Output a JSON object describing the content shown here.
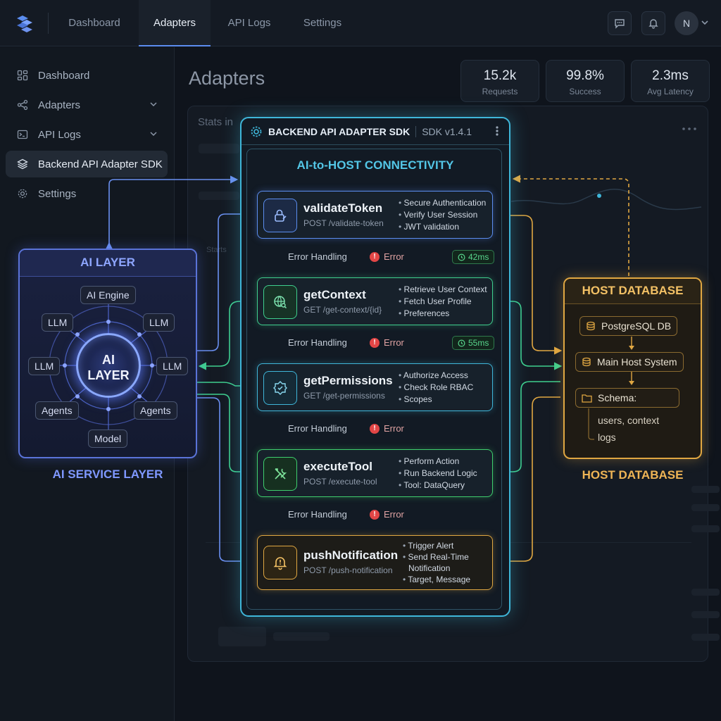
{
  "nav": {
    "tabs": [
      {
        "label": "Dashboard"
      },
      {
        "label": "Adapters"
      },
      {
        "label": "API Logs"
      },
      {
        "label": "Settings"
      }
    ],
    "active_tab": "Adapters",
    "avatar_initial": "N"
  },
  "sidebar": {
    "items": [
      {
        "label": "Dashboard",
        "icon": "grid-icon"
      },
      {
        "label": "Adapters",
        "icon": "share-nodes-icon"
      },
      {
        "label": "API Logs",
        "icon": "terminal-icon"
      },
      {
        "label": "Backend API Adapter SDK",
        "icon": "layers-icon"
      },
      {
        "label": "Settings",
        "icon": "gear-icon"
      }
    ],
    "active_item": "Backend API Adapter SDK"
  },
  "main": {
    "title": "Adapters",
    "stats": [
      {
        "value": "15.2k",
        "label": "Requests"
      },
      {
        "value": "99.8%",
        "label": "Success"
      },
      {
        "value": "2.3ms",
        "label": "Avg Latency"
      }
    ],
    "bg_panel_label": "Stats in",
    "bg_panel_label2": "Starts"
  },
  "ai_layer": {
    "title": "AI LAYER",
    "core_line1": "AI",
    "core_line2": "LAYER",
    "nodes": [
      "AI Engine",
      "LLM",
      "LLM",
      "LLM",
      "LLM",
      "Agents",
      "Agents",
      "Model"
    ],
    "caption": "AI SERVICE LAYER"
  },
  "sdk": {
    "title": "BACKEND API ADAPTER SDK",
    "version": "SDK v1.4.1",
    "subtitle": "AI-to-HOST CONNECTIVITY",
    "endpoints": [
      {
        "name": "validateToken",
        "path": "POST /validate-token",
        "bullets": [
          "Secure Authentication",
          "Verify User Session",
          "JWT validation"
        ],
        "icon": "lock-icon",
        "color": "#5b8def"
      },
      {
        "name": "getContext",
        "path": "GET /get-context/{id}",
        "bullets": [
          "Retrieve User Context",
          "Fetch User Profile",
          "Preferences"
        ],
        "icon": "globe-search-icon",
        "color": "#3fcf8e"
      },
      {
        "name": "getPermissions",
        "path": "GET /get-permissions",
        "bullets": [
          "Authorize Access",
          "Check Role RBAC",
          "Scopes"
        ],
        "icon": "shield-badge-icon",
        "color": "#3fb6d9"
      },
      {
        "name": "executeTool",
        "path": "POST /execute-tool",
        "bullets": [
          "Perform Action",
          "Run Backend Logic",
          "Tool: DataQuery"
        ],
        "icon": "tools-icon",
        "color": "#3fcf6e"
      },
      {
        "name": "pushNotification",
        "path": "POST /push-notification",
        "bullets": [
          "Trigger Alert",
          "Send Real-Time",
          "Notification",
          "Target, Message"
        ],
        "icon": "bell-alert-icon",
        "color": "#e0a742"
      }
    ],
    "error_handling_label": "Error Handling",
    "error_label": "Error",
    "timers": [
      "42ms",
      "55ms"
    ]
  },
  "host_db": {
    "title": "HOST DATABASE",
    "items": [
      "PostgreSQL DB",
      "Main Host System",
      "Schema:"
    ],
    "schema_lines": [
      "users, context",
      "logs"
    ],
    "caption": "HOST DATABASE"
  },
  "colors": {
    "accent_blue": "#5b8def",
    "sdk_cyan": "#3fb6d9",
    "success_green": "#3fcf8e",
    "error_red": "#e24646",
    "db_amber": "#e0a742",
    "ai_indigo": "#5a73d8"
  }
}
